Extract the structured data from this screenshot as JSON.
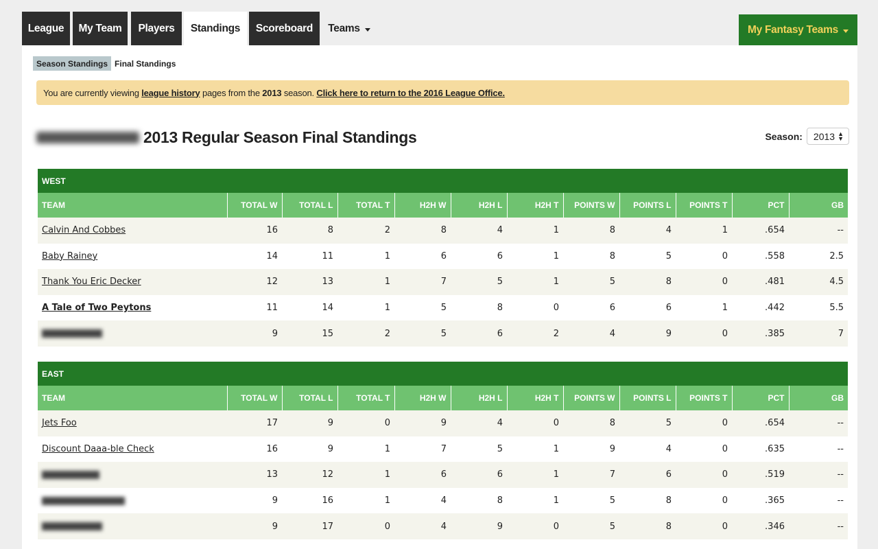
{
  "nav": {
    "tabs": [
      {
        "label": "League"
      },
      {
        "label": "My Team"
      },
      {
        "label": "Players"
      },
      {
        "label": "Standings"
      },
      {
        "label": "Scoreboard"
      },
      {
        "label": "Teams"
      }
    ],
    "my_fantasy_teams": "My Fantasy Teams"
  },
  "subtabs": [
    "Season Standings",
    "Final Standings"
  ],
  "banner": {
    "prefix": "You are currently viewing ",
    "link1": "league history",
    "middle": " pages from the ",
    "year": "2013",
    "suffix": " season. ",
    "link2": "Click here to return to the 2016 League Office."
  },
  "page_title": "2013 Regular Season Final Standings",
  "season": {
    "label": "Season:",
    "value": "2013"
  },
  "columns": [
    "TEAM",
    "TOTAL W",
    "TOTAL L",
    "TOTAL T",
    "H2H W",
    "H2H L",
    "H2H T",
    "POINTS W",
    "POINTS L",
    "POINTS T",
    "PCT",
    "GB"
  ],
  "divisions": [
    {
      "name": "WEST",
      "rows": [
        {
          "team": "Calvin And Cobbes",
          "stats": [
            "16",
            "8",
            "2",
            "8",
            "4",
            "1",
            "8",
            "4",
            "1",
            ".654",
            "--"
          ]
        },
        {
          "team": "Baby Rainey",
          "stats": [
            "14",
            "11",
            "1",
            "6",
            "6",
            "1",
            "8",
            "5",
            "0",
            ".558",
            "2.5"
          ]
        },
        {
          "team": "Thank You Eric Decker",
          "stats": [
            "12",
            "13",
            "1",
            "7",
            "5",
            "1",
            "5",
            "8",
            "0",
            ".481",
            "4.5"
          ]
        },
        {
          "team": "A Tale of Two Peytons",
          "bold": true,
          "stats": [
            "11",
            "14",
            "1",
            "5",
            "8",
            "0",
            "6",
            "6",
            "1",
            ".442",
            "5.5"
          ]
        },
        {
          "team": "",
          "blurred": true,
          "stats": [
            "9",
            "15",
            "2",
            "5",
            "6",
            "2",
            "4",
            "9",
            "0",
            ".385",
            "7"
          ]
        }
      ]
    },
    {
      "name": "EAST",
      "rows": [
        {
          "team": "Jets Foo",
          "stats": [
            "17",
            "9",
            "0",
            "9",
            "4",
            "0",
            "8",
            "5",
            "0",
            ".654",
            "--"
          ]
        },
        {
          "team": "Discount Daaa-ble Check",
          "stats": [
            "16",
            "9",
            "1",
            "7",
            "5",
            "1",
            "9",
            "4",
            "0",
            ".635",
            "--"
          ]
        },
        {
          "team": "",
          "blurred": true,
          "stats": [
            "13",
            "12",
            "1",
            "6",
            "6",
            "1",
            "7",
            "6",
            "0",
            ".519",
            "--"
          ]
        },
        {
          "team": "",
          "blurred": true,
          "stats": [
            "9",
            "16",
            "1",
            "4",
            "8",
            "1",
            "5",
            "8",
            "0",
            ".365",
            "--"
          ]
        },
        {
          "team": "",
          "blurred": true,
          "stats": [
            "9",
            "17",
            "0",
            "4",
            "9",
            "0",
            "5",
            "8",
            "0",
            ".346",
            "--"
          ]
        }
      ]
    }
  ]
}
